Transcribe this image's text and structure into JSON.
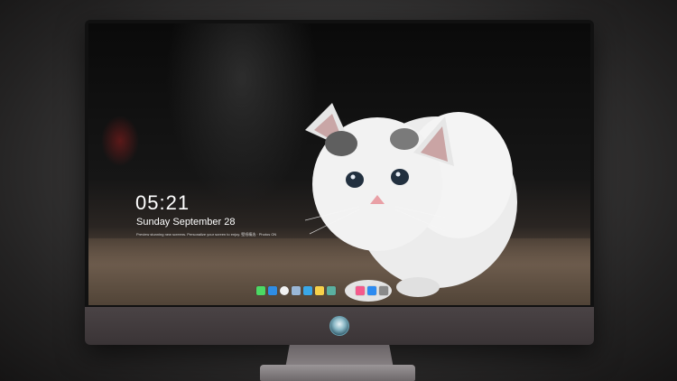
{
  "lock_screen": {
    "time": "05:21",
    "date": "Sunday September  28",
    "notice": "Preview stunning new screens. Personalize your screen to enjoy. 壁纸精选 · Photos ON"
  },
  "dock": {
    "apps": [
      {
        "icon": "messages-icon",
        "color": "#4cd964"
      },
      {
        "icon": "finder-icon",
        "color": "#2f8de4"
      },
      {
        "icon": "clock-icon",
        "color": "#f2f2f2"
      },
      {
        "icon": "preview-icon",
        "color": "#9ab7d6"
      },
      {
        "icon": "clapper-icon",
        "color": "#3aa8e8"
      },
      {
        "icon": "notes-icon",
        "color": "#f7d14a"
      },
      {
        "icon": "photos-icon",
        "color": "#5ab0a0"
      },
      {
        "icon": "music-icon",
        "color": "#f45a8c"
      },
      {
        "icon": "app-store-icon",
        "color": "#2d8bf0"
      },
      {
        "icon": "camera-icon",
        "color": "#8a8a8a"
      }
    ]
  }
}
